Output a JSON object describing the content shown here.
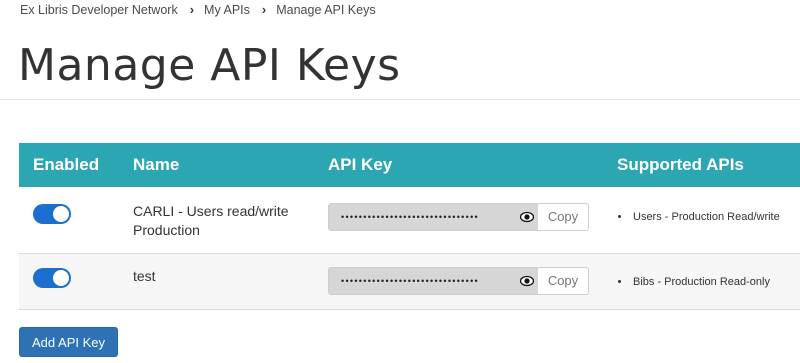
{
  "breadcrumb": {
    "items": [
      "Ex Libris Developer Network",
      "My APIs",
      "Manage API Keys"
    ]
  },
  "page": {
    "title": "Manage API Keys"
  },
  "table": {
    "headers": {
      "enabled": "Enabled",
      "name": "Name",
      "api_key": "API Key",
      "supported_apis": "Supported APIs"
    },
    "rows": [
      {
        "enabled": true,
        "name": "CARLI - Users read/write Production",
        "api_key_masked": "•••••••••••••••••••••••••••••••",
        "copy_label": "Copy",
        "supported_apis": [
          "Users - Production Read/write"
        ]
      },
      {
        "enabled": true,
        "name": "test",
        "api_key_masked": "•••••••••••••••••••••••••••••••",
        "copy_label": "Copy",
        "supported_apis": [
          "Bibs - Production Read-only"
        ]
      }
    ]
  },
  "actions": {
    "add_key_label": "Add API Key"
  },
  "colors": {
    "header_bg": "#2ca6b2",
    "toggle_on": "#1c6fd1",
    "button_bg": "#2e72b5"
  }
}
